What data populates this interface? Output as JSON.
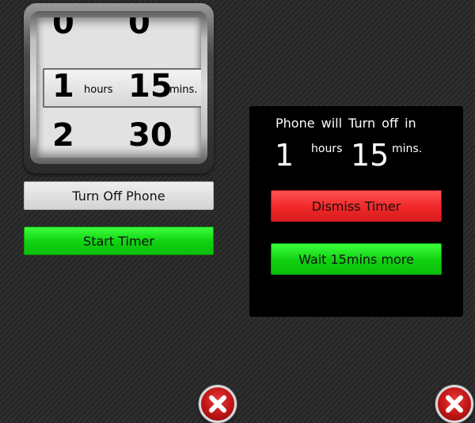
{
  "picker": {
    "rows": [
      {
        "hours": "0",
        "minutes": "0"
      },
      {
        "hours": "1",
        "minutes": "15",
        "hours_unit": "hours",
        "minutes_unit": "mins."
      },
      {
        "hours": "2",
        "minutes": "30"
      }
    ]
  },
  "buttons": {
    "turn_off_phone": "Turn Off Phone",
    "start_timer": "Start Timer"
  },
  "dialog": {
    "title": "Phone will Turn off in",
    "hours": "1",
    "hours_unit": "hours",
    "minutes": "15",
    "minutes_unit": "mins.",
    "dismiss_label": "Dismiss Timer",
    "wait_label": "Wait 15mins more"
  },
  "colors": {
    "green": "#10d010",
    "red": "#f02727",
    "dialog_bg": "#000000"
  },
  "icons": {
    "close": "close-icon"
  }
}
